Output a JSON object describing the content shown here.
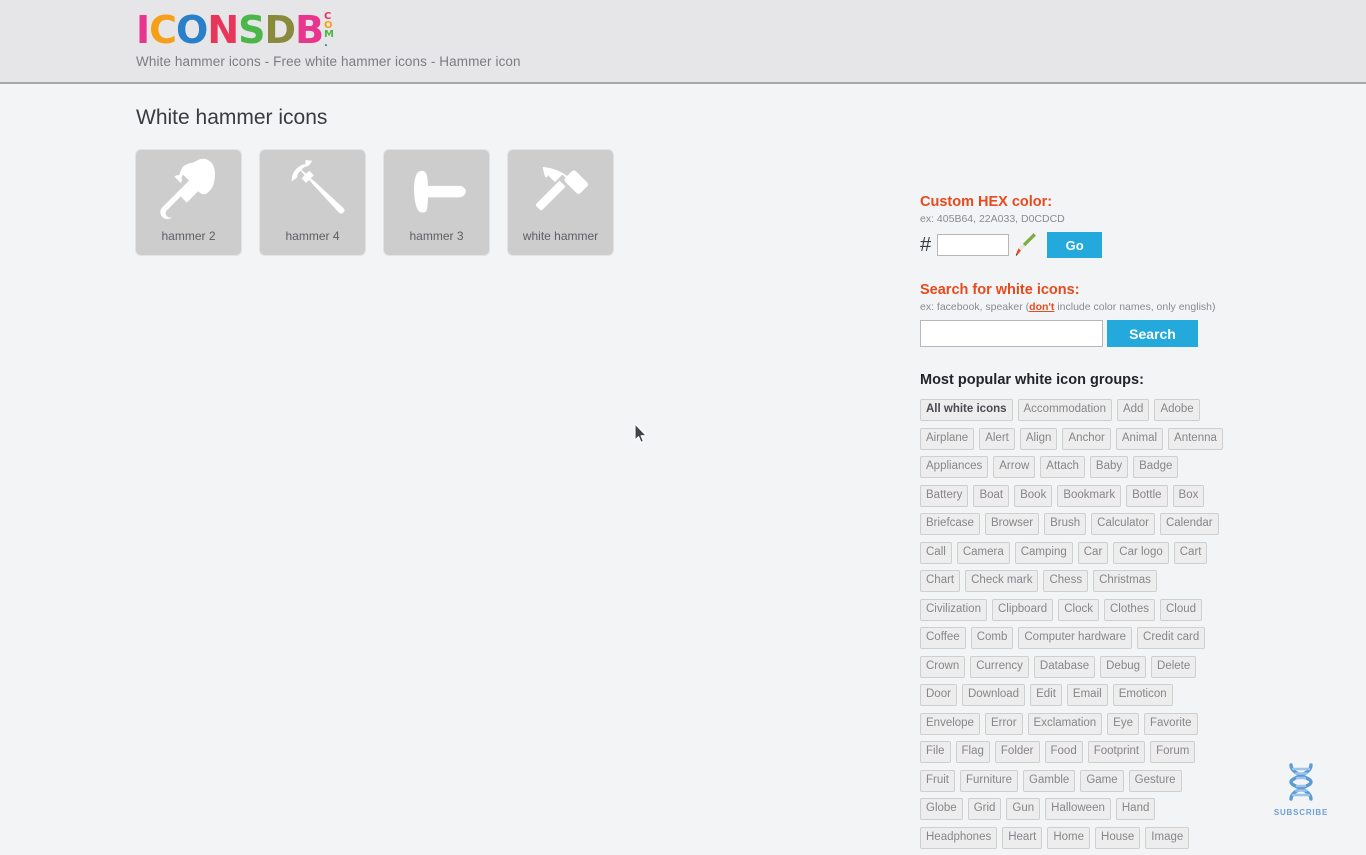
{
  "site": {
    "logo_letters": [
      {
        "char": "I",
        "color": "#e8368f"
      },
      {
        "char": "C",
        "color": "#f6a01a"
      },
      {
        "char": "O",
        "color": "#2a7fc9"
      },
      {
        "char": "N",
        "color": "#e8365a"
      },
      {
        "char": "S",
        "color": "#4cb648"
      },
      {
        "char": "D",
        "color": "#8a8a3c"
      },
      {
        "char": "B",
        "color": "#e8368f"
      }
    ],
    "logo_dotcom": [
      {
        "char": "C",
        "color": "#e8365a"
      },
      {
        "char": "O",
        "color": "#f6a01a"
      },
      {
        "char": "M",
        "color": "#4cb648"
      },
      {
        "char": ".",
        "color": "#2a7fc9"
      }
    ],
    "tagline": "White hammer icons - Free white hammer icons - Hammer icon",
    "header_bg": "#e6e6e8",
    "body_bg": "#f3f4f6"
  },
  "main": {
    "page_title": "White hammer icons",
    "icons": [
      {
        "caption": "hammer 2",
        "glyph": "hammer-2-icon"
      },
      {
        "caption": "hammer 4",
        "glyph": "hammer-4-icon"
      },
      {
        "caption": "hammer 3",
        "glyph": "hammer-3-icon"
      },
      {
        "caption": "white hammer",
        "glyph": "white-hammer-icon"
      }
    ]
  },
  "sidebar": {
    "hex": {
      "heading": "Custom HEX color:",
      "hint": "ex: 405B64, 22A033, D0CDCD",
      "hash": "#",
      "value": "",
      "placeholder": "",
      "go_label": "Go",
      "eyedropper_icon": "eyedropper-icon",
      "accent": "#e8491d",
      "button_color": "#24a9dc"
    },
    "search": {
      "heading": "Search for white icons:",
      "hint_prefix": "ex: facebook, speaker (",
      "hint_emph": "don't",
      "hint_suffix": " include color names, only english)",
      "value": "",
      "placeholder": "",
      "button_label": "Search"
    },
    "groups": {
      "heading": "Most popular white icon groups:",
      "rows": [
        [
          "All white icons",
          "Accommodation",
          "Add",
          "Adobe"
        ],
        [
          "Airplane",
          "Alert",
          "Align",
          "Anchor",
          "Animal",
          "Antenna"
        ],
        [
          "Appliances",
          "Arrow",
          "Attach",
          "Baby",
          "Badge"
        ],
        [
          "Battery",
          "Boat",
          "Book",
          "Bookmark",
          "Bottle",
          "Box"
        ],
        [
          "Briefcase",
          "Browser",
          "Brush",
          "Calculator",
          "Calendar"
        ],
        [
          "Call",
          "Camera",
          "Camping",
          "Car",
          "Car logo",
          "Cart"
        ],
        [
          "Chart",
          "Check mark",
          "Chess",
          "Christmas"
        ],
        [
          "Civilization",
          "Clipboard",
          "Clock",
          "Clothes",
          "Cloud"
        ],
        [
          "Coffee",
          "Comb",
          "Computer hardware",
          "Credit card"
        ],
        [
          "Crown",
          "Currency",
          "Database",
          "Debug",
          "Delete"
        ],
        [
          "Door",
          "Download",
          "Edit",
          "Email",
          "Emoticon"
        ],
        [
          "Envelope",
          "Error",
          "Exclamation",
          "Eye",
          "Favorite"
        ],
        [
          "File",
          "Flag",
          "Folder",
          "Food",
          "Footprint",
          "Forum"
        ],
        [
          "Fruit",
          "Furniture",
          "Gamble",
          "Game",
          "Gesture"
        ],
        [
          "Globe",
          "Grid",
          "Gun",
          "Halloween",
          "Hand"
        ],
        [
          "Headphones",
          "Heart",
          "Home",
          "House",
          "Image"
        ]
      ],
      "active": "All white icons"
    }
  },
  "subscribe": {
    "label": "SUBSCRIBE",
    "icon": "dna-helix-icon",
    "color": "#5b9bd5"
  }
}
